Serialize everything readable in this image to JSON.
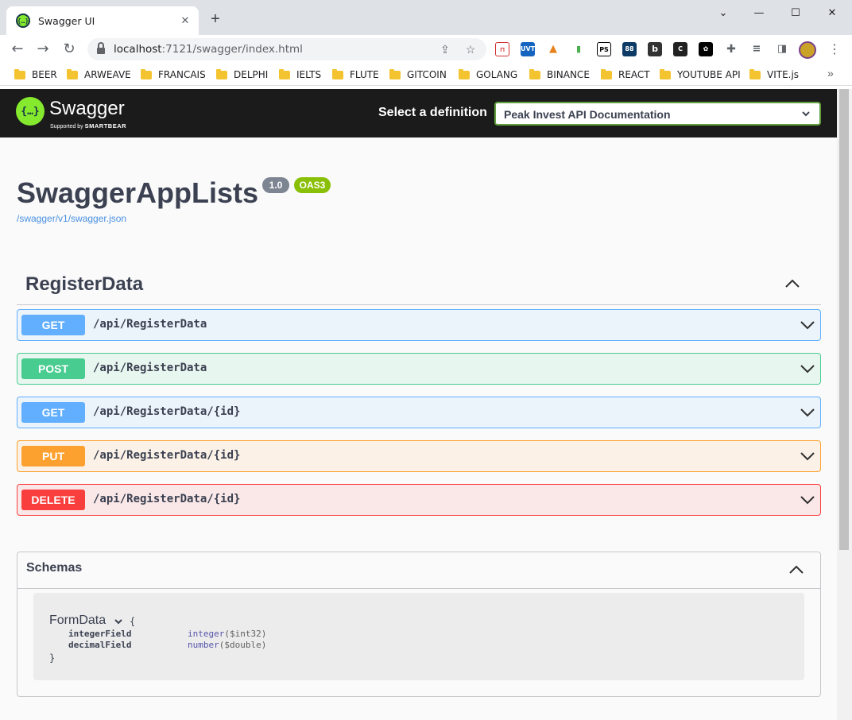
{
  "browser": {
    "tab_title": "Swagger UI",
    "tab_close": "✕",
    "new_tab": "+",
    "url_host": "localhost",
    "url_rest": ":7121/swagger/index.html",
    "bookmarks": [
      "BEER",
      "ARWEAVE",
      "FRANCAIS",
      "DELPHI",
      "IELTS",
      "FLUTE",
      "GITCOIN",
      "GOLANG",
      "BINANCE",
      "REACT",
      "YOUTUBE API",
      "VITE.js"
    ],
    "bookmarks_more": "»",
    "window_controls": [
      "⌄",
      "—",
      "☐",
      "✕"
    ]
  },
  "topbar": {
    "logo_mark": "{…}",
    "logo_text": "Swagger",
    "logo_sub_prefix": "Supported by",
    "logo_sub_brand": "SMARTBEAR",
    "select_label": "Select a definition",
    "selected_definition": "Peak Invest API Documentation"
  },
  "info": {
    "title": "SwaggerAppLists",
    "version": "1.0",
    "oas": "OAS3",
    "spec_url": "/swagger/v1/swagger.json"
  },
  "tag": {
    "name": "RegisterData",
    "operations": [
      {
        "method": "GET",
        "path": "/api/RegisterData"
      },
      {
        "method": "POST",
        "path": "/api/RegisterData"
      },
      {
        "method": "GET",
        "path": "/api/RegisterData/{id}"
      },
      {
        "method": "PUT",
        "path": "/api/RegisterData/{id}"
      },
      {
        "method": "DELETE",
        "path": "/api/RegisterData/{id}"
      }
    ]
  },
  "schemas": {
    "title": "Schemas",
    "model": {
      "name": "FormData",
      "open_brace": "{",
      "close_brace": "}",
      "properties": [
        {
          "name": "integerField",
          "type": "integer",
          "format": "($int32)"
        },
        {
          "name": "decimalField",
          "type": "number",
          "format": "($double)"
        }
      ]
    }
  },
  "colors": {
    "get": "#61affe",
    "post": "#49cc90",
    "put": "#fca130",
    "delete": "#f93e3e",
    "swagger_green": "#85ea2d",
    "topbar": "#1b1b1b"
  }
}
